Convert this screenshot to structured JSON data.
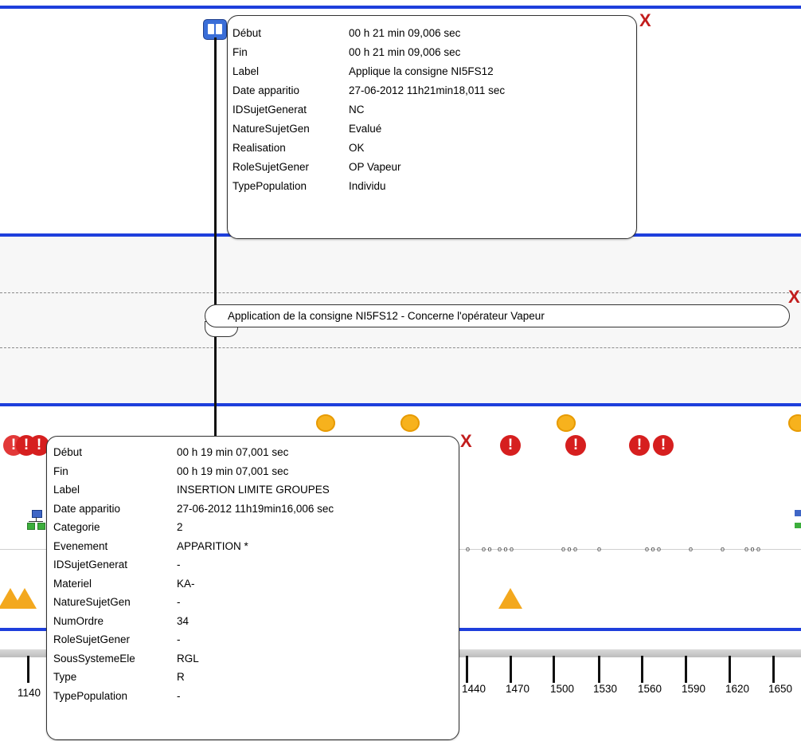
{
  "top_popup": {
    "close": "X",
    "rows": [
      {
        "key": "Début",
        "value": "00 h 21 min 09,006 sec"
      },
      {
        "key": "Fin",
        "value": "00 h 21 min 09,006 sec"
      },
      {
        "key": "Label",
        "value": "Applique la consigne NI5FS12"
      },
      {
        "key": "Date apparitio",
        "value": "27-06-2012 11h21min18,011 sec"
      },
      {
        "key": "IDSujetGenerat",
        "value": "NC"
      },
      {
        "key": "NatureSujetGen",
        "value": "Evalué"
      },
      {
        "key": "Realisation",
        "value": "OK"
      },
      {
        "key": "RoleSujetGener",
        "value": "OP Vapeur"
      },
      {
        "key": "TypePopulation",
        "value": "Individu"
      }
    ]
  },
  "annotation": {
    "text": "Application de la consigne NI5FS12 - Concerne l'opérateur Vapeur",
    "close": "X"
  },
  "bottom_popup": {
    "close": "X",
    "rows": [
      {
        "key": "Début",
        "value": "00 h 19 min 07,001 sec"
      },
      {
        "key": "Fin",
        "value": "00 h 19 min 07,001 sec"
      },
      {
        "key": "Label",
        "value": "INSERTION LIMITE GROUPES"
      },
      {
        "key": "Date apparitio",
        "value": "27-06-2012 11h19min16,006 sec"
      },
      {
        "key": "Categorie",
        "value": "2"
      },
      {
        "key": "Evenement",
        "value": "APPARITION *"
      },
      {
        "key": "IDSujetGenerat",
        "value": "-"
      },
      {
        "key": "Materiel",
        "value": "KA-"
      },
      {
        "key": "NatureSujetGen",
        "value": "-"
      },
      {
        "key": "NumOrdre",
        "value": "34"
      },
      {
        "key": "RoleSujetGener",
        "value": "-"
      },
      {
        "key": "SousSystemeEle",
        "value": "RGL"
      },
      {
        "key": "Type",
        "value": "R"
      },
      {
        "key": "TypePopulation",
        "value": "-"
      }
    ]
  },
  "timeline": {
    "left_label": "1140",
    "labels": [
      "1440",
      "1470",
      "1500",
      "1530",
      "1560",
      "1590",
      "1620",
      "1650"
    ]
  },
  "icons": {
    "alert_glyph": "!",
    "colors": {
      "line_blue": "#1e3fdc",
      "alert_red": "#d61f1f",
      "warn_orange": "#f3a81e",
      "close_red": "#c21d1d"
    }
  }
}
